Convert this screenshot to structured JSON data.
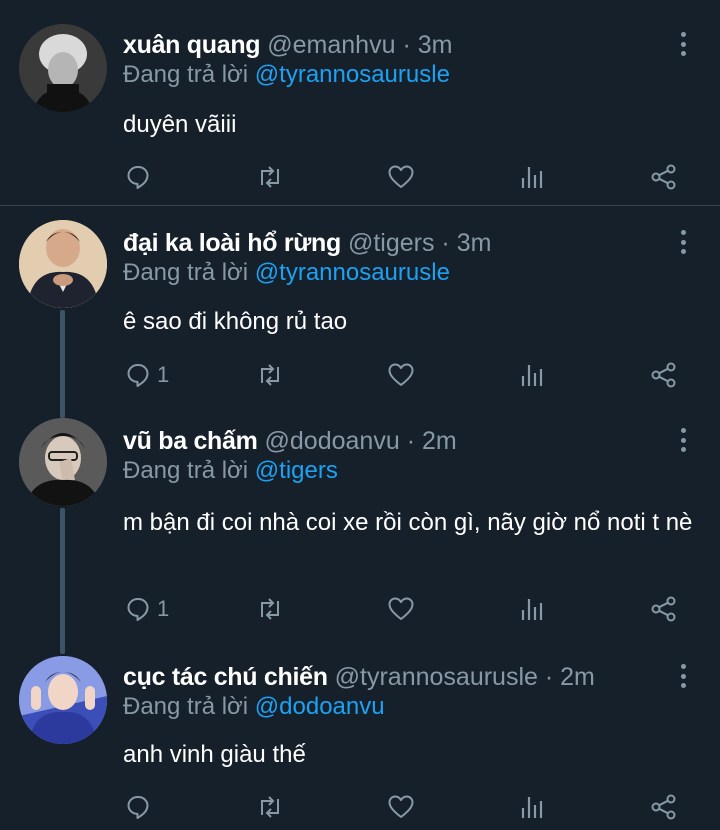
{
  "replying_prefix": "Đang trả lời",
  "tweets": [
    {
      "name": "xuân quang",
      "handle": "@emanhvu",
      "separator": "·",
      "time": "3m",
      "reply_to": "@tyrannosaurusle",
      "text": "duyên vãiii",
      "reply_count": ""
    },
    {
      "name": "đại ka loài hổ rừng",
      "handle": "@tigers",
      "separator": "·",
      "time": "3m",
      "reply_to": "@tyrannosaurusle",
      "text": "ê sao đi không rủ tao",
      "reply_count": "1"
    },
    {
      "name": "vũ ba chấm",
      "handle": "@dodoanvu",
      "separator": "·",
      "time": "2m",
      "reply_to": "@tigers",
      "text": "m bận đi coi nhà coi xe rồi còn gì, nãy giờ nổ noti t nè",
      "reply_count": "1"
    },
    {
      "name": "cục tác chú chiến",
      "handle": "@tyrannosaurusle",
      "separator": "·",
      "time": "2m",
      "reply_to": "@dodoanvu",
      "text": "anh vinh giàu thế",
      "reply_count": ""
    }
  ],
  "colors": {
    "background": "#15202b",
    "muted": "#8899a6",
    "mention": "#1da1f2",
    "divider": "#38444d",
    "thread_line": "#3d5466"
  },
  "icons": {
    "reply": "comment-bubble-icon",
    "retweet": "retweet-arrows-icon",
    "like": "heart-icon",
    "analytics": "bar-chart-icon",
    "share": "share-icon",
    "more": "vertical-ellipsis-icon"
  }
}
